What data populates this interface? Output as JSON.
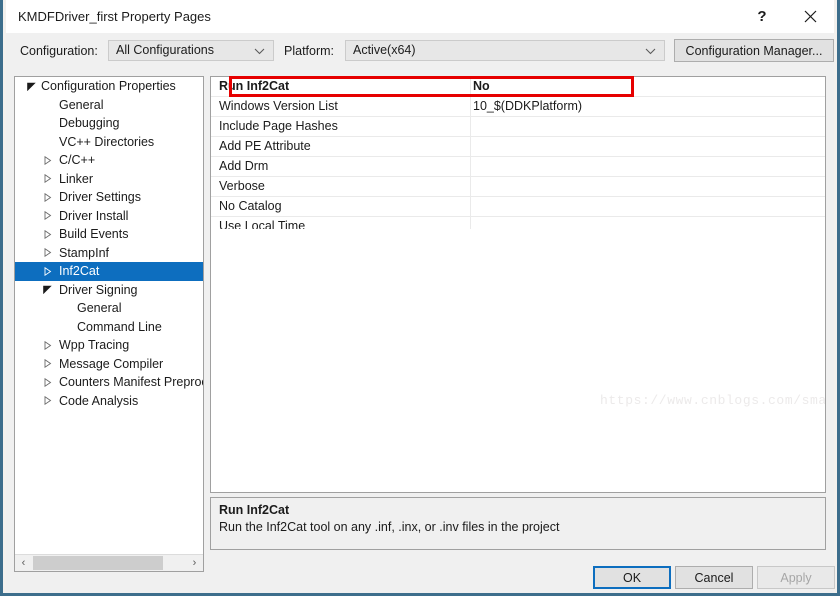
{
  "window": {
    "title": "KMDFDriver_first Property Pages",
    "help_glyph": "?",
    "close_glyph": "×"
  },
  "config_bar": {
    "configuration_label": "Configuration:",
    "configuration_value": "All Configurations",
    "platform_label": "Platform:",
    "platform_value": "Active(x64)",
    "configuration_manager_label": "Configuration Manager..."
  },
  "tree": {
    "items": [
      {
        "label": "Configuration Properties",
        "depth": 0,
        "expander": "expanded",
        "selected": false
      },
      {
        "label": "General",
        "depth": 1,
        "expander": "none",
        "selected": false
      },
      {
        "label": "Debugging",
        "depth": 1,
        "expander": "none",
        "selected": false
      },
      {
        "label": "VC++ Directories",
        "depth": 1,
        "expander": "none",
        "selected": false
      },
      {
        "label": "C/C++",
        "depth": 1,
        "expander": "collapsed",
        "selected": false
      },
      {
        "label": "Linker",
        "depth": 1,
        "expander": "collapsed",
        "selected": false
      },
      {
        "label": "Driver Settings",
        "depth": 1,
        "expander": "collapsed",
        "selected": false
      },
      {
        "label": "Driver Install",
        "depth": 1,
        "expander": "collapsed",
        "selected": false
      },
      {
        "label": "Build Events",
        "depth": 1,
        "expander": "collapsed",
        "selected": false
      },
      {
        "label": "StampInf",
        "depth": 1,
        "expander": "collapsed",
        "selected": false
      },
      {
        "label": "Inf2Cat",
        "depth": 1,
        "expander": "collapsed",
        "selected": true
      },
      {
        "label": "Driver Signing",
        "depth": 1,
        "expander": "expanded",
        "selected": false
      },
      {
        "label": "General",
        "depth": 2,
        "expander": "none",
        "selected": false
      },
      {
        "label": "Command Line",
        "depth": 2,
        "expander": "none",
        "selected": false
      },
      {
        "label": "Wpp Tracing",
        "depth": 1,
        "expander": "collapsed",
        "selected": false
      },
      {
        "label": "Message Compiler",
        "depth": 1,
        "expander": "collapsed",
        "selected": false
      },
      {
        "label": "Counters Manifest Preproc",
        "depth": 1,
        "expander": "collapsed",
        "selected": false
      },
      {
        "label": "Code Analysis",
        "depth": 1,
        "expander": "collapsed",
        "selected": false
      }
    ],
    "scroll_left_glyph": "‹",
    "scroll_right_glyph": "›"
  },
  "grid": {
    "rows": [
      {
        "name": "Run Inf2Cat",
        "value": "No",
        "current": true
      },
      {
        "name": "Windows Version List",
        "value": "10_$(DDKPlatform)",
        "current": false
      },
      {
        "name": "Include Page Hashes",
        "value": "",
        "current": false
      },
      {
        "name": "Add PE Attribute",
        "value": "",
        "current": false
      },
      {
        "name": "Add Drm",
        "value": "",
        "current": false
      },
      {
        "name": "Verbose",
        "value": "",
        "current": false
      },
      {
        "name": "No Catalog",
        "value": "",
        "current": false
      },
      {
        "name": "Use Local Time",
        "value": "",
        "current": false
      }
    ]
  },
  "description": {
    "title": "Run Inf2Cat",
    "body": "Run the Inf2Cat tool on any .inf, .inx, or .inv files in the project"
  },
  "watermark": {
    "text": "https://www.cnblogs.com/smart-zihan/"
  },
  "buttons": {
    "ok": "OK",
    "cancel": "Cancel",
    "apply": "Apply"
  },
  "colors": {
    "selection_blue": "#0d6ebf",
    "highlight_red": "#e60000",
    "window_border": "#3d6e8c",
    "panel_bg": "#f0f0f0"
  }
}
